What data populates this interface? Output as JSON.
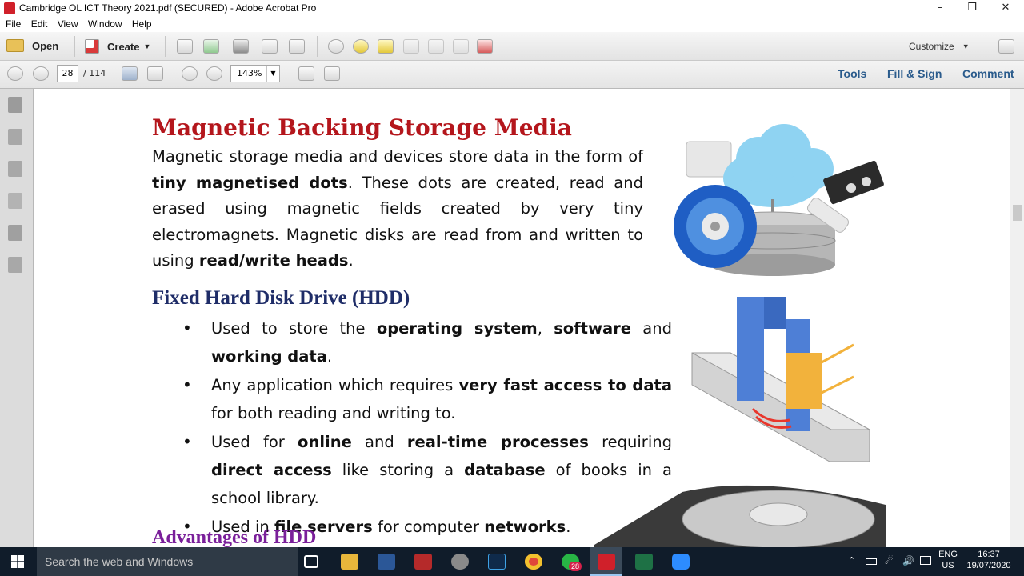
{
  "window": {
    "title": "Cambridge OL ICT Theory 2021.pdf (SECURED) - Adobe Acrobat Pro",
    "minimize_icon": "minimize-icon",
    "restore_icon": "restore-icon",
    "close_icon": "close-icon"
  },
  "menu": [
    "File",
    "Edit",
    "View",
    "Window",
    "Help"
  ],
  "toolbar": {
    "open_label": "Open",
    "create_label": "Create",
    "customize_label": "Customize"
  },
  "nav": {
    "page_current": "28",
    "page_total": "/ 114",
    "zoom": "143%"
  },
  "panels": {
    "tools": "Tools",
    "fill_sign": "Fill & Sign",
    "comment": "Comment"
  },
  "doc": {
    "heading": "Magnetic Backing Storage Media",
    "para_parts": [
      "Magnetic storage media and devices store data in the form of ",
      "tiny magnetised dots",
      ". These dots are created, read and erased using magnetic fields created by very tiny electromagnets. Magnetic disks are read from and written to using ",
      "read/write heads",
      "."
    ],
    "subheading": "Fixed Hard Disk Drive (HDD)",
    "bullets": [
      [
        "Used to store the ",
        "operating system",
        ", ",
        "software",
        " and ",
        "working data",
        "."
      ],
      [
        "Any application which requires ",
        "very fast access to data",
        " for both reading and writing to."
      ],
      [
        "Used for ",
        "online",
        " and ",
        "real-time processes",
        " requiring ",
        "direct access",
        " like storing a ",
        "database",
        " of books in a school library."
      ],
      [
        "Used in ",
        "file servers",
        " for computer ",
        "networks",
        "."
      ]
    ],
    "next_heading": "Advantages of HDD"
  },
  "taskbar": {
    "search_placeholder": "Search the web and Windows",
    "whatsapp_badge": "28",
    "lang_line1": "ENG",
    "lang_line2": "US",
    "time": "16:37",
    "date": "19/07/2020"
  },
  "colors": {
    "heading_red": "#b4161c",
    "subheading_navy": "#1f2d68",
    "advantages_purple": "#7a1f9a",
    "panel_link_blue": "#2a5b8c"
  }
}
